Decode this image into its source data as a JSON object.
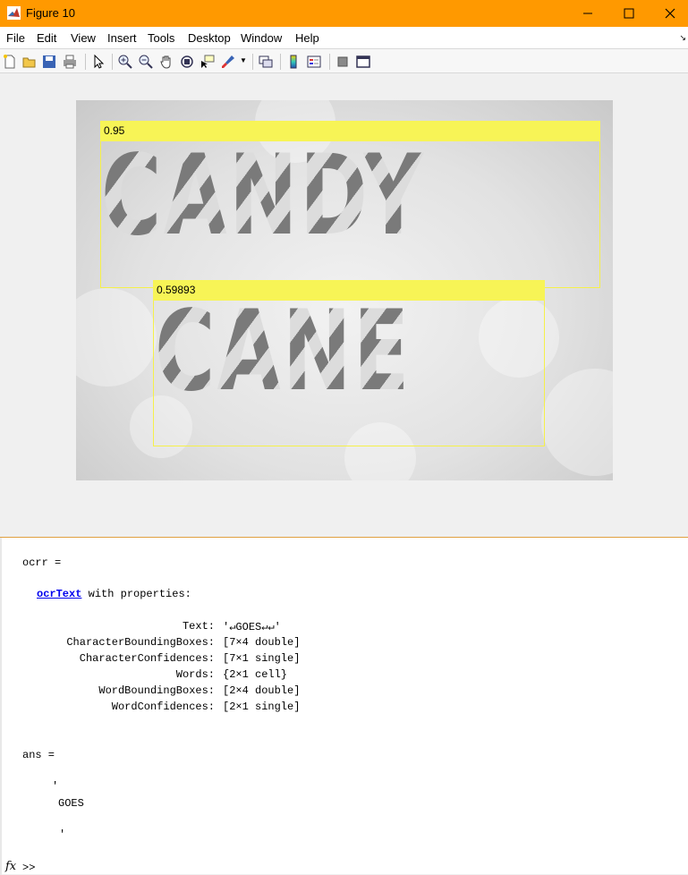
{
  "window": {
    "title": "Figure 10",
    "accent_color": "#ff9900"
  },
  "menu": {
    "items": [
      "File",
      "Edit",
      "View",
      "Insert",
      "Tools",
      "Desktop",
      "Window",
      "Help"
    ]
  },
  "toolbar": {
    "icons": [
      "new-figure-icon",
      "open-file-icon",
      "save-figure-icon",
      "print-figure-icon",
      "edit-plot-icon",
      "zoom-in-icon",
      "zoom-out-icon",
      "pan-icon",
      "rotate-3d-icon",
      "data-cursor-icon",
      "brush-icon",
      "link-plot-icon",
      "insert-colorbar-icon",
      "insert-legend-icon",
      "hide-plot-tools-icon",
      "show-plot-tools-icon"
    ]
  },
  "figure": {
    "image_words": [
      "CANDY",
      "CANE"
    ],
    "detections": [
      {
        "label": "0.95"
      },
      {
        "label": "0.59893"
      }
    ],
    "box_color": "#f7f456"
  },
  "command_window": {
    "var1": "ocrr =",
    "class_link": "ocrText",
    "with_props": " with properties:",
    "properties": [
      {
        "name": "Text:",
        "value": "'↵GOES↵↵'"
      },
      {
        "name": "CharacterBoundingBoxes:",
        "value": "[7×4 double]"
      },
      {
        "name": "CharacterConfidences:",
        "value": "[7×1 single]"
      },
      {
        "name": "Words:",
        "value": "{2×1 cell}"
      },
      {
        "name": "WordBoundingBoxes:",
        "value": "[2×4 double]"
      },
      {
        "name": "WordConfidences:",
        "value": "[2×1 single]"
      }
    ],
    "var2": "ans =",
    "ans_quote_open": "'",
    "ans_text": "GOES",
    "ans_quote_close": "'",
    "prompt_fx": "fx",
    "prompt": ">>"
  }
}
